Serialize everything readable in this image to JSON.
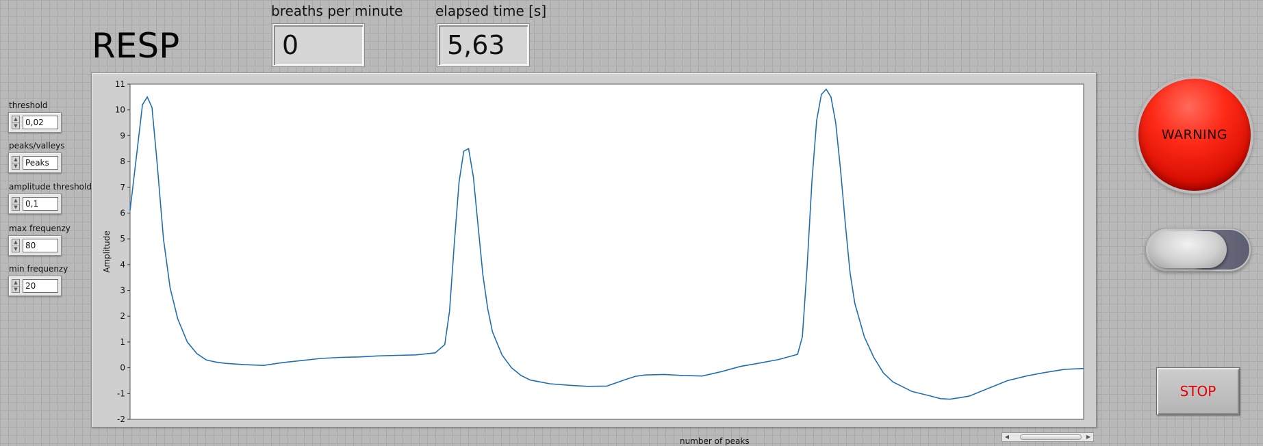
{
  "title": "RESP",
  "indicators": {
    "breaths_label": "breaths per minute",
    "breaths_value": "0",
    "elapsed_label": "elapsed time [s]",
    "elapsed_value": "5,63"
  },
  "controls": [
    {
      "label": "threshold",
      "value": "0,02"
    },
    {
      "label": "peaks/valleys",
      "value": "Peaks"
    },
    {
      "label": "amplitude threshold",
      "value": "0,1"
    },
    {
      "label": "max frequenzy",
      "value": "80"
    },
    {
      "label": "min frequenzy",
      "value": "20"
    }
  ],
  "warning": {
    "label": "WARNING",
    "color": "#ff2a18"
  },
  "toggle": {
    "state": "off"
  },
  "stop": {
    "label": "STOP",
    "color": "#e30000"
  },
  "chart_data": {
    "type": "line",
    "ylabel": "Amplitude",
    "xlabel": "number of peaks",
    "ylim": [
      -2,
      11
    ],
    "yticks": [
      "11",
      "10",
      "9",
      "8",
      "7",
      "6",
      "5",
      "4",
      "3",
      "2",
      "1",
      "0",
      "-1",
      "-2"
    ],
    "line_color": "#1f6fb0",
    "grid": false,
    "series": [
      {
        "x": [
          0,
          0.8,
          1.3,
          1.8,
          2.3,
          2.8,
          3.5,
          4.2,
          5,
          6,
          7,
          8,
          9,
          10,
          12,
          14,
          16,
          18,
          20,
          22,
          24,
          26,
          28,
          30,
          32,
          33,
          33.5,
          34,
          34.5,
          35,
          35.5,
          36,
          36.5,
          37,
          37.5,
          38,
          39,
          40,
          41,
          42,
          43,
          44,
          46,
          48,
          50,
          52,
          53,
          54,
          56,
          58,
          60,
          62,
          64,
          66,
          68,
          70,
          70.5,
          71,
          71.5,
          72,
          72.5,
          73,
          73.5,
          74,
          74.5,
          75,
          75.5,
          76,
          77,
          78,
          79,
          80,
          82,
          84,
          85,
          86,
          88,
          90,
          92,
          94,
          96,
          98,
          100
        ],
        "y": [
          6.1,
          8.6,
          10.2,
          10.5,
          10.1,
          8.1,
          5.0,
          3.1,
          1.9,
          1.0,
          0.55,
          0.3,
          0.22,
          0.17,
          0.12,
          0.09,
          0.2,
          0.28,
          0.36,
          0.4,
          0.42,
          0.46,
          0.48,
          0.5,
          0.58,
          0.9,
          2.2,
          4.8,
          7.2,
          8.4,
          8.5,
          7.4,
          5.5,
          3.6,
          2.3,
          1.4,
          0.5,
          0.0,
          -0.3,
          -0.48,
          -0.55,
          -0.62,
          -0.68,
          -0.72,
          -0.71,
          -0.45,
          -0.33,
          -0.28,
          -0.26,
          -0.3,
          -0.32,
          -0.15,
          0.05,
          0.18,
          0.32,
          0.52,
          1.2,
          3.9,
          7.2,
          9.6,
          10.6,
          10.8,
          10.5,
          9.5,
          7.7,
          5.6,
          3.7,
          2.5,
          1.2,
          0.4,
          -0.2,
          -0.55,
          -0.92,
          -1.1,
          -1.2,
          -1.22,
          -1.1,
          -0.8,
          -0.5,
          -0.32,
          -0.18,
          -0.06,
          -0.03
        ]
      }
    ]
  }
}
